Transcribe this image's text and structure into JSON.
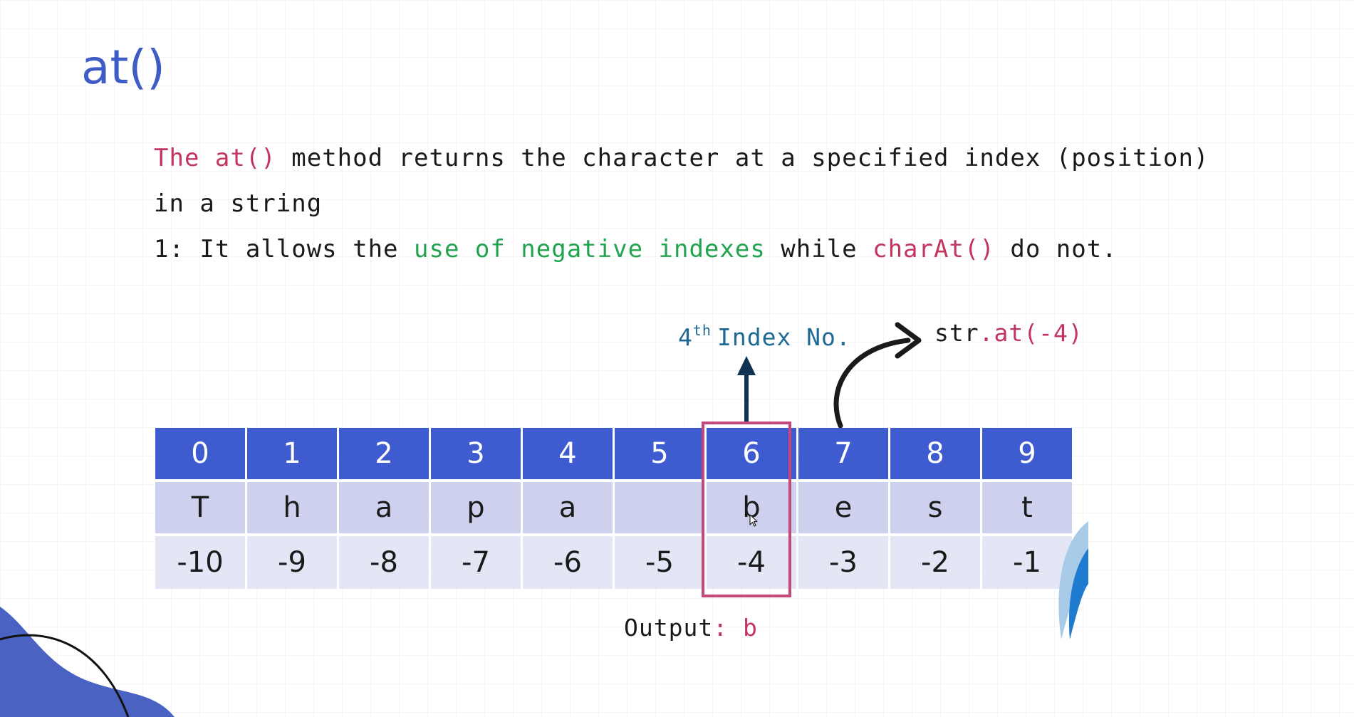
{
  "title": "at()",
  "description": {
    "line1_prefix": "The at()",
    "line1_rest": " method returns the character at a specified index (position)",
    "line2": "in a string",
    "line3_prefix": "1: It allows the ",
    "line3_green": "use of negative indexes",
    "line3_mid": " while ",
    "line3_pink": "charAt()",
    "line3_end": " do not."
  },
  "annotation": {
    "ordinal_number": "4",
    "ordinal_suffix": "th",
    "label": "Index No.",
    "code_prefix": "str",
    "code_method": ".at(-4)"
  },
  "table": {
    "indexes": [
      "0",
      "1",
      "2",
      "3",
      "4",
      "5",
      "6",
      "7",
      "8",
      "9"
    ],
    "chars": [
      "T",
      "h",
      "a",
      "p",
      "a",
      "",
      "b",
      "e",
      "s",
      "t"
    ],
    "negative_indexes": [
      "-10",
      "-9",
      "-8",
      "-7",
      "-6",
      "-5",
      "-4",
      "-3",
      "-2",
      "-1"
    ],
    "highlighted_column": 6
  },
  "output": {
    "label": "Output",
    "separator": ": ",
    "value": "b"
  },
  "colors": {
    "title": "#3E5BC6",
    "index_row": "#3E5BD0",
    "char_row": "#CDD1EE",
    "negative_row": "#E4E6F5",
    "highlight_border": "#C4487A",
    "pink_text": "#C2355F",
    "green_text": "#21A34F",
    "annotation_blue": "#1E6A93"
  },
  "icons": {
    "up_arrow": "arrow-up-icon",
    "curved_arrow": "curved-arrow-icon",
    "cursor": "mouse-cursor-icon"
  }
}
